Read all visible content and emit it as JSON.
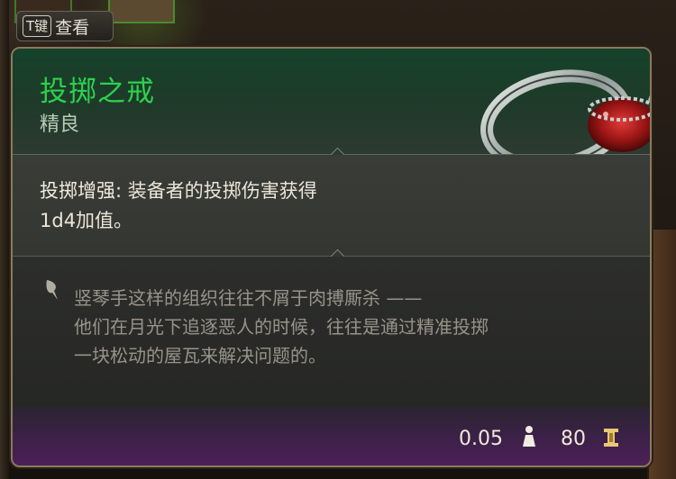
{
  "hint": {
    "key": "T键",
    "label": "查看"
  },
  "item": {
    "name": "投掷之戒",
    "rarity": "精良",
    "effect_name": "投掷增强:",
    "effect_desc_line1": "装备者的投掷伤害获得",
    "effect_desc_line2": "1d4加值。",
    "lore_lines": [
      "竖琴手这样的组织往往不屑于肉搏厮杀 ——",
      "他们在月光下追逐恶人的时候，往往是通过精准投掷",
      "一块松动的屋瓦来解决问题的。"
    ],
    "weight": "0.05",
    "price": "80"
  },
  "icons": {
    "weight": "weight-icon",
    "price": "gold-coin-icon",
    "lore": "quill-icon",
    "item": "ring-image"
  },
  "colors": {
    "title": "#2ed14d",
    "rarity": "#b8ccb6",
    "header_bg": "#15422a",
    "footer_bg": "#4c2057",
    "border": "#8a7a5e"
  }
}
